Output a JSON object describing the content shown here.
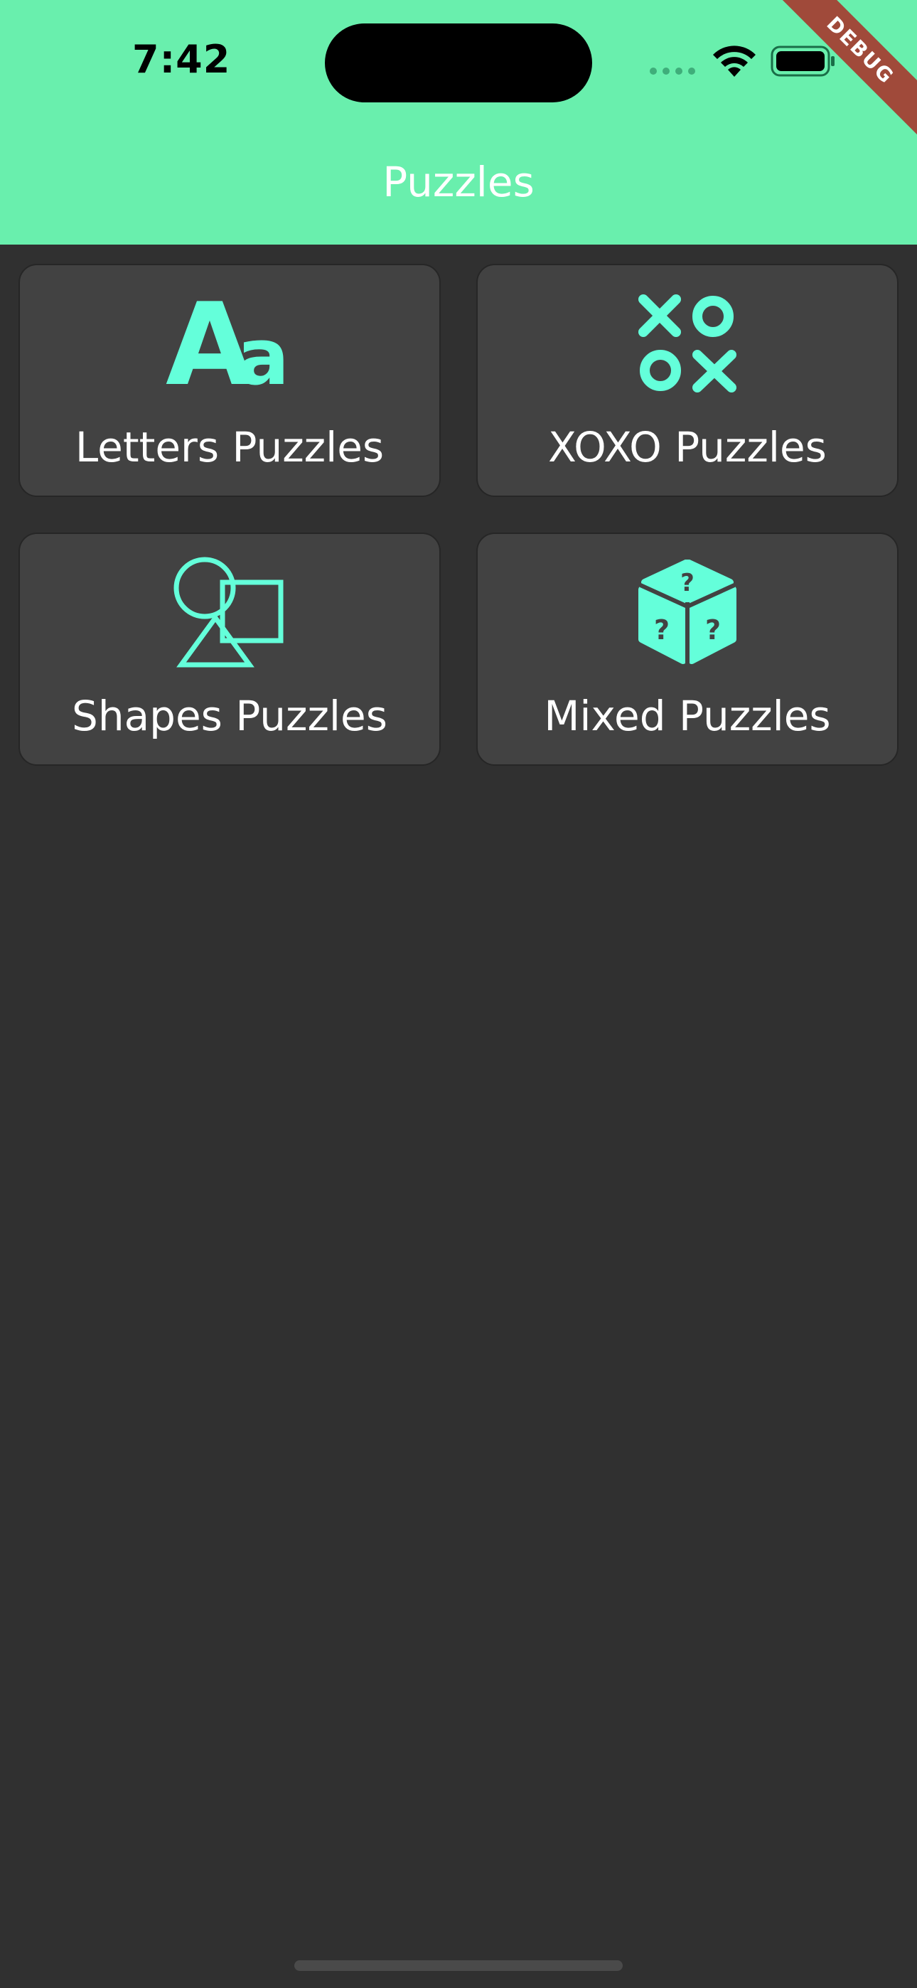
{
  "status_bar": {
    "time": "7:42"
  },
  "debug_banner": "DEBUG",
  "app_bar": {
    "title": "Puzzles"
  },
  "colors": {
    "accent": "#69EFAD",
    "icon": "#64FFDA",
    "background": "#303030",
    "card": "#424242"
  },
  "puzzles": [
    {
      "label": "Letters Puzzles",
      "icon": "letters-icon"
    },
    {
      "label": "XOXO Puzzles",
      "icon": "tic-tac-toe-icon"
    },
    {
      "label": "Shapes Puzzles",
      "icon": "shapes-icon"
    },
    {
      "label": "Mixed Puzzles",
      "icon": "dice-question-icon"
    }
  ]
}
